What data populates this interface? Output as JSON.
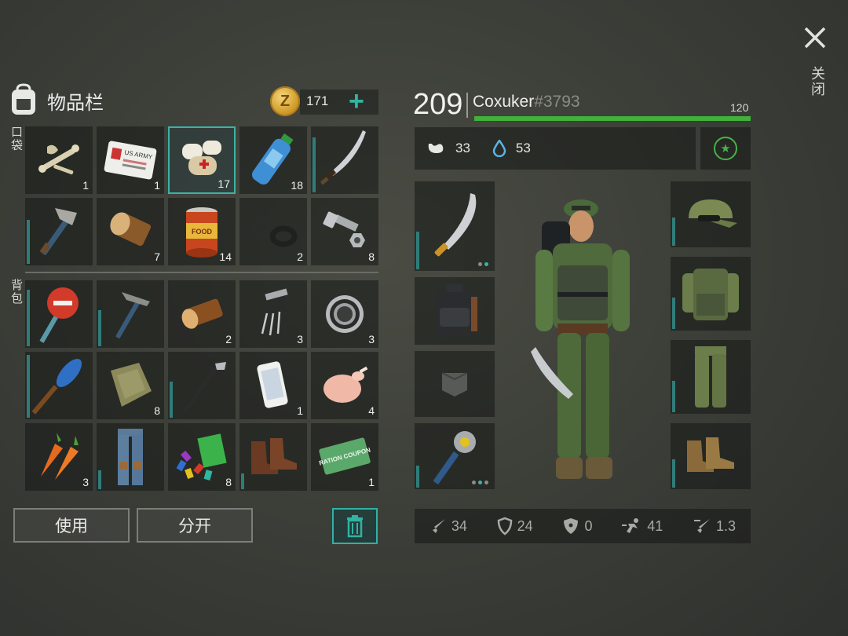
{
  "inventory": {
    "title": "物品栏",
    "coins": "171",
    "pocket_label": "口袋",
    "backpack_label": "背包",
    "pocket_slots": [
      {
        "item": "bones-icon",
        "qty": "1"
      },
      {
        "item": "id-card-icon",
        "qty": "1",
        "card_text": "US ARMY"
      },
      {
        "item": "bandage-icon",
        "qty": "17",
        "selected": true
      },
      {
        "item": "water-bottle-icon",
        "qty": "18"
      },
      {
        "item": "katana-icon",
        "qty": ""
      },
      {
        "item": "hatchet-icon",
        "qty": ""
      },
      {
        "item": "log-icon",
        "qty": "7"
      },
      {
        "item": "canned-food-icon",
        "qty": "14",
        "label": "FOOD"
      },
      {
        "item": "rubber-seal-icon",
        "qty": "2"
      },
      {
        "item": "bolt-nut-icon",
        "qty": "8"
      }
    ],
    "backpack_slots": [
      {
        "item": "stop-sign-icon",
        "qty": ""
      },
      {
        "item": "pickaxe-icon",
        "qty": ""
      },
      {
        "item": "log-icon",
        "qty": "2"
      },
      {
        "item": "transistor-icon",
        "qty": "3"
      },
      {
        "item": "bearing-icon",
        "qty": "3"
      },
      {
        "item": "paddle-icon",
        "qty": ""
      },
      {
        "item": "cloth-icon",
        "qty": "8"
      },
      {
        "item": "golf-club-icon",
        "qty": ""
      },
      {
        "item": "smartphone-icon",
        "qty": "1"
      },
      {
        "item": "raw-chicken-icon",
        "qty": "4"
      },
      {
        "item": "carrot-icon",
        "qty": "3"
      },
      {
        "item": "pants-icon",
        "qty": ""
      },
      {
        "item": "battery-pack-icon",
        "qty": "8"
      },
      {
        "item": "boots-icon",
        "qty": ""
      },
      {
        "item": "ration-coupon-icon",
        "qty": "1",
        "label": "RATION COUPON"
      }
    ],
    "use_button": "使用",
    "split_button": "分开"
  },
  "player": {
    "level": "209",
    "name": "Coxuker",
    "tag": "#3793",
    "hp": "120",
    "hunger": "33",
    "thirst": "53"
  },
  "stats": {
    "attack": "34",
    "defense": "24",
    "radiation": "0",
    "speed": "41",
    "attack_speed": "1.3"
  },
  "close_label": "关闭",
  "colors": {
    "accent": "#3bb3a6",
    "health": "#41b13b",
    "coin": "#d9a431"
  }
}
